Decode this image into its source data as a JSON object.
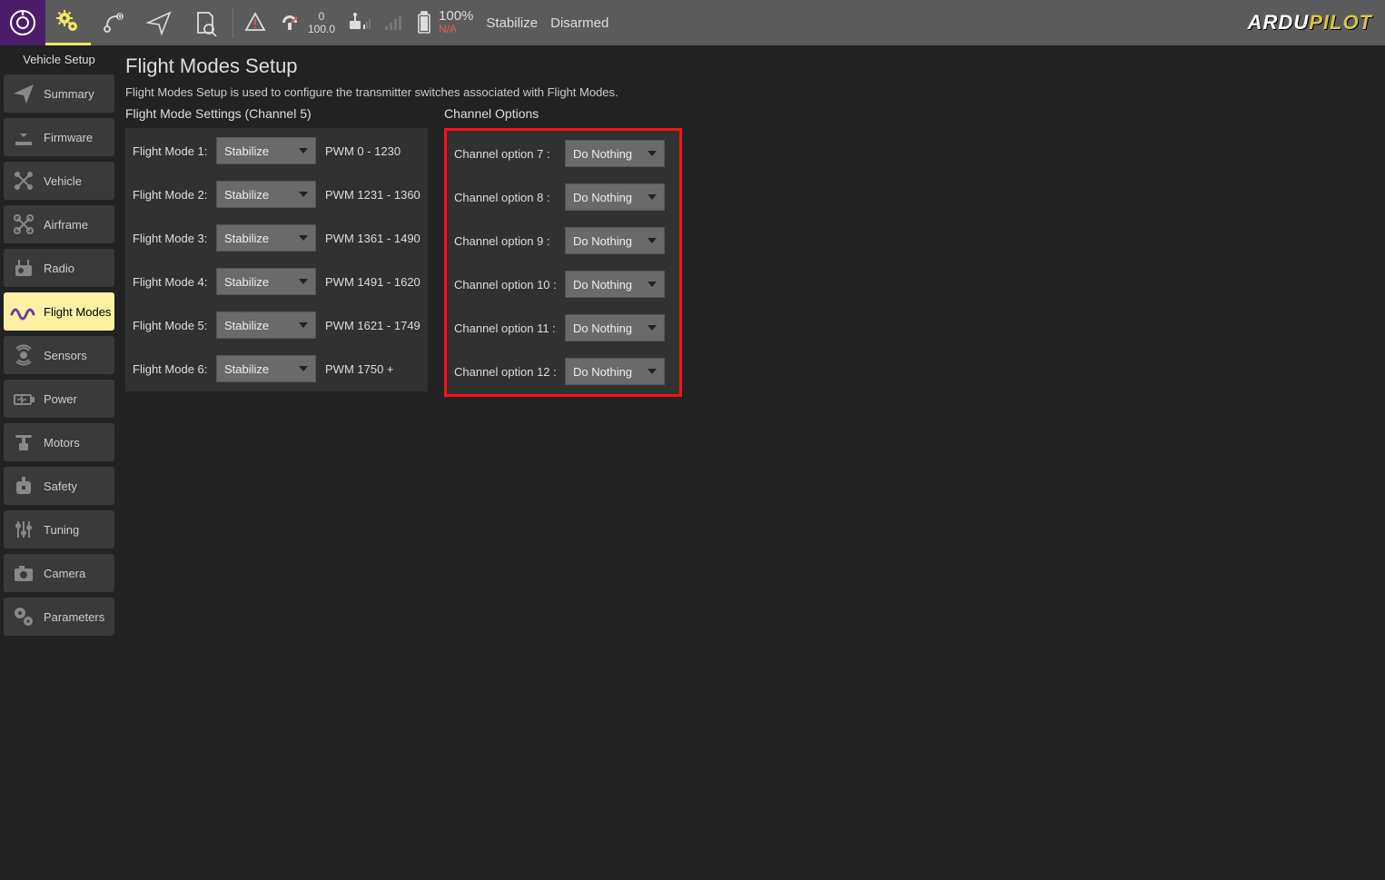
{
  "toolbar": {
    "sat_top": "0",
    "sat_bottom": "100.0",
    "battery_pct": "100%",
    "battery_na": "N/A",
    "mode": "Stabilize",
    "armed": "Disarmed",
    "brand_a": "ARDU",
    "brand_b": "PILOT"
  },
  "sidebar": {
    "title": "Vehicle Setup",
    "items": [
      {
        "label": "Summary"
      },
      {
        "label": "Firmware"
      },
      {
        "label": "Vehicle"
      },
      {
        "label": "Airframe"
      },
      {
        "label": "Radio"
      },
      {
        "label": "Flight Modes",
        "selected": true
      },
      {
        "label": "Sensors"
      },
      {
        "label": "Power"
      },
      {
        "label": "Motors"
      },
      {
        "label": "Safety"
      },
      {
        "label": "Tuning"
      },
      {
        "label": "Camera"
      },
      {
        "label": "Parameters"
      }
    ]
  },
  "main": {
    "title": "Flight Modes Setup",
    "desc": "Flight Modes Setup is used to configure the transmitter switches associated with Flight Modes.",
    "flight_section_label": "Flight Mode Settings (Channel 5)",
    "channel_section_label": "Channel Options",
    "flight_modes": [
      {
        "label": "Flight Mode 1:",
        "value": "Stabilize",
        "pwm": "PWM 0 - 1230"
      },
      {
        "label": "Flight Mode 2:",
        "value": "Stabilize",
        "pwm": "PWM 1231 - 1360"
      },
      {
        "label": "Flight Mode 3:",
        "value": "Stabilize",
        "pwm": "PWM 1361 - 1490"
      },
      {
        "label": "Flight Mode 4:",
        "value": "Stabilize",
        "pwm": "PWM 1491 - 1620"
      },
      {
        "label": "Flight Mode 5:",
        "value": "Stabilize",
        "pwm": "PWM 1621 - 1749"
      },
      {
        "label": "Flight Mode 6:",
        "value": "Stabilize",
        "pwm": "PWM 1750 +"
      }
    ],
    "channel_options": [
      {
        "label": "Channel option 7 :",
        "value": "Do Nothing"
      },
      {
        "label": "Channel option 8 :",
        "value": "Do Nothing"
      },
      {
        "label": "Channel option 9 :",
        "value": "Do Nothing"
      },
      {
        "label": "Channel option 10 :",
        "value": "Do Nothing"
      },
      {
        "label": "Channel option 11 :",
        "value": "Do Nothing"
      },
      {
        "label": "Channel option 12 :",
        "value": "Do Nothing"
      }
    ]
  }
}
